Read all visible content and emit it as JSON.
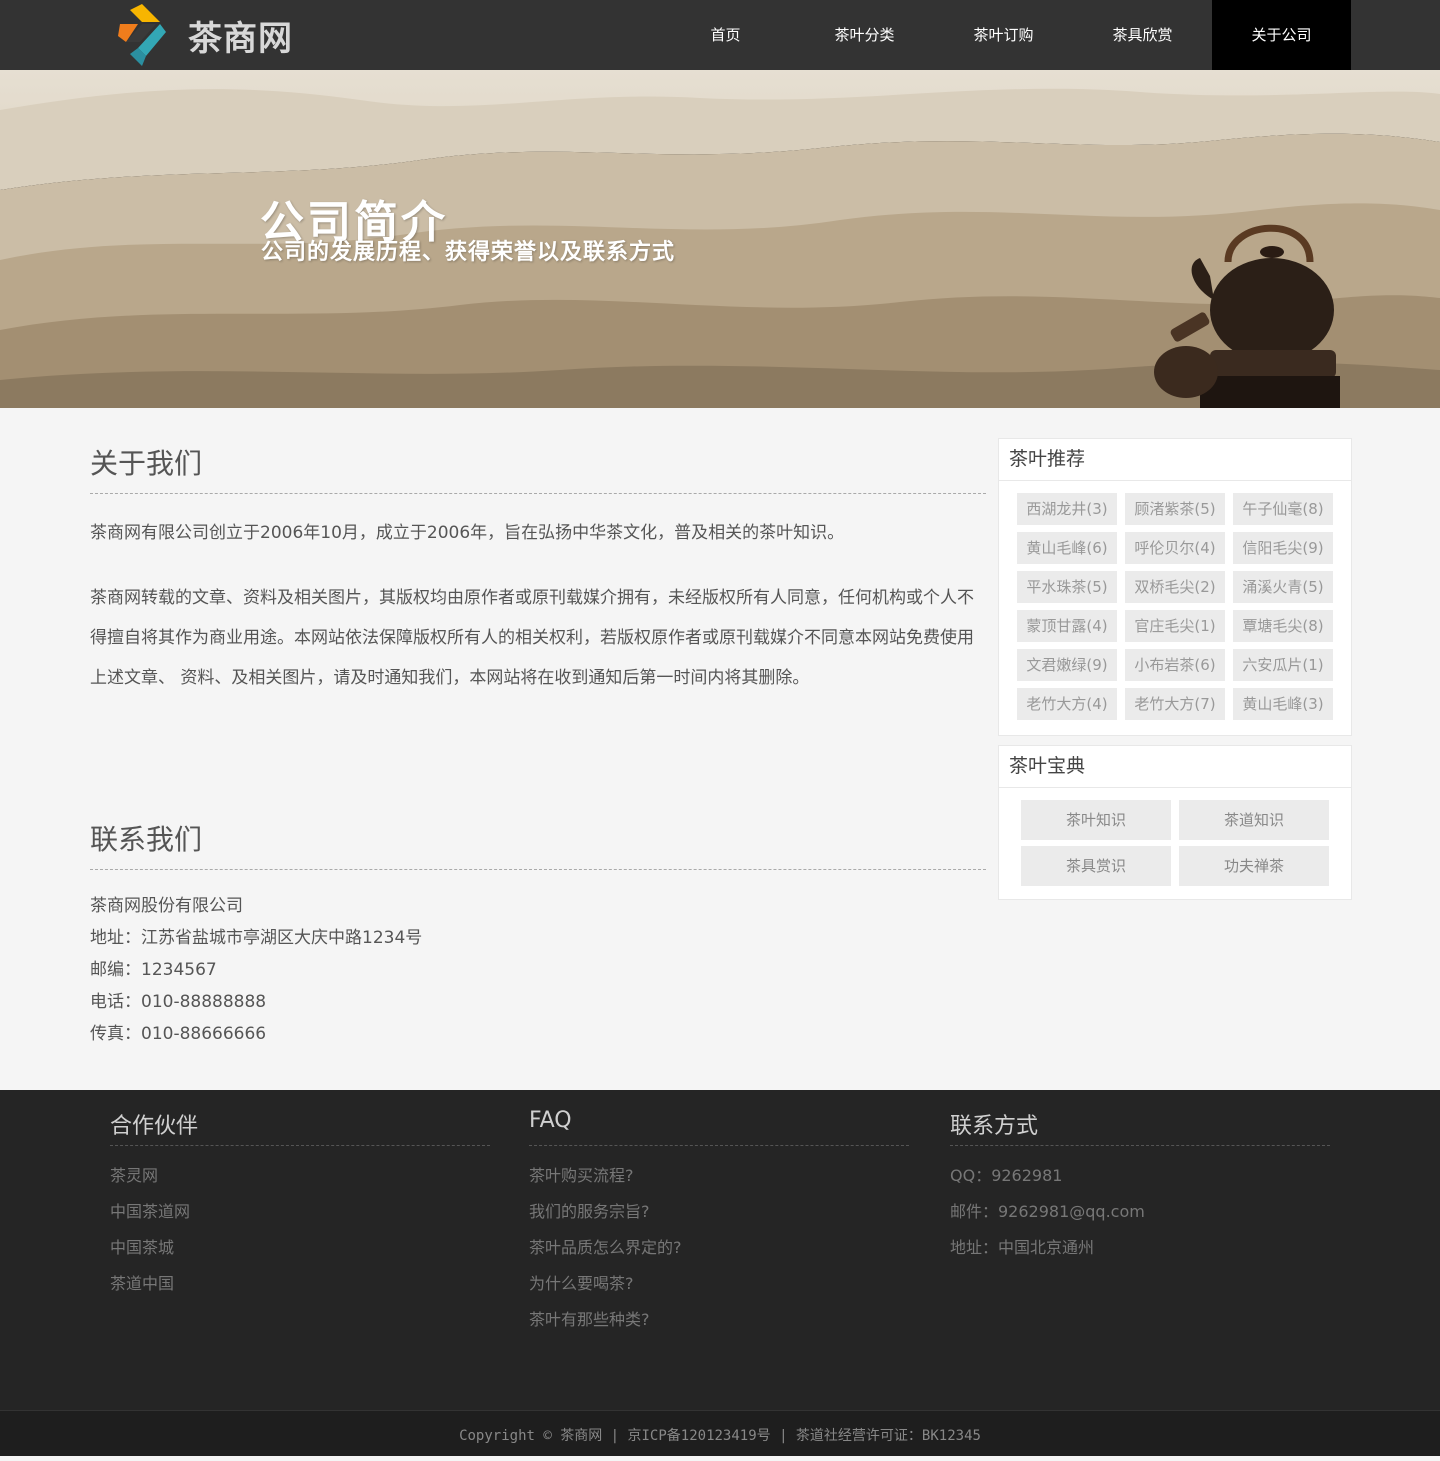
{
  "header": {
    "logo_text": "茶商网",
    "nav": [
      {
        "label": "首页"
      },
      {
        "label": "茶叶分类"
      },
      {
        "label": "茶叶订购"
      },
      {
        "label": "茶具欣赏"
      },
      {
        "label": "关于公司"
      }
    ],
    "active_index": 4
  },
  "banner": {
    "title": "公司简介",
    "subtitle": "公司的发展历程、获得荣誉以及联系方式"
  },
  "about": {
    "title": "关于我们",
    "p1": "茶商网有限公司创立于2006年10月，成立于2006年，旨在弘扬中华茶文化，普及相关的茶叶知识。",
    "p2": "茶商网转载的文章、资料及相关图片，其版权均由原作者或原刊载媒介拥有，未经版权所有人同意，任何机构或个人不得擅自将其作为商业用途。本网站依法保障版权所有人的相关权利，若版权原作者或原刊载媒介不同意本网站免费使用上述文章、 资料、及相关图片，请及时通知我们，本网站将在收到通知后第一时间内将其删除。"
  },
  "contact": {
    "title": "联系我们",
    "company": "茶商网股份有限公司",
    "address": "地址：江苏省盐城市亭湖区大庆中路1234号",
    "zip": "邮编：1234567",
    "phone": "电话：010-88888888",
    "fax": "传真：010-88666666"
  },
  "sidebar": {
    "recommend": {
      "title": "茶叶推荐",
      "tags": [
        "西湖龙井(3)",
        "顾渚紫茶(5)",
        "午子仙毫(8)",
        "黄山毛峰(6)",
        "呼伦贝尔(4)",
        "信阳毛尖(9)",
        "平水珠茶(5)",
        "双桥毛尖(2)",
        "涌溪火青(5)",
        "蒙顶甘露(4)",
        "官庄毛尖(1)",
        "覃塘毛尖(8)",
        "文君嫩绿(9)",
        "小布岩茶(6)",
        "六安瓜片(1)",
        "老竹大方(4)",
        "老竹大方(7)",
        "黄山毛峰(3)"
      ]
    },
    "handbook": {
      "title": "茶叶宝典",
      "items": [
        "茶叶知识",
        "茶道知识",
        "茶具赏识",
        "功夫禅茶"
      ]
    }
  },
  "footer": {
    "partners": {
      "title": "合作伙伴",
      "items": [
        "茶灵网",
        "中国茶道网",
        "中国茶城",
        "茶道中国"
      ]
    },
    "faq": {
      "title": "FAQ",
      "items": [
        "茶叶购买流程?",
        "我们的服务宗旨?",
        "茶叶品质怎么界定的?",
        "为什么要喝茶?",
        "茶叶有那些种类?"
      ]
    },
    "contact": {
      "title": "联系方式",
      "items": [
        "QQ：9262981",
        "邮件：9262981@qq.com",
        "地址：中国北京通州"
      ]
    },
    "copyright": "Copyright © 茶商网 | 京ICP备120123419号 | 茶道社经营许可证：BK12345"
  },
  "colors": {
    "header_bg": "#333333",
    "nav_active_bg": "#000000",
    "footer_bg": "#252525",
    "page_bg": "#f5f5f5",
    "tag_bg": "#ebebeb"
  }
}
